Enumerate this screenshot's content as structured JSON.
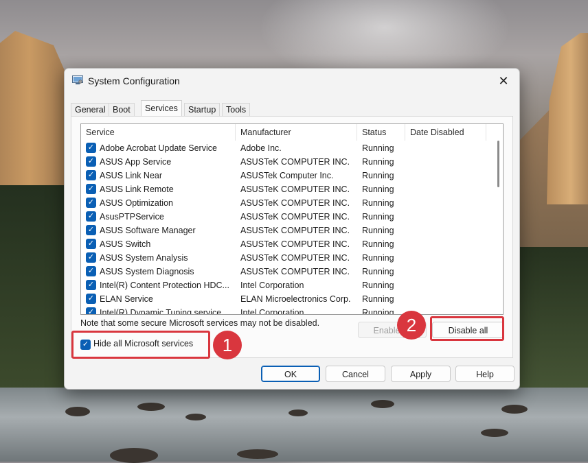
{
  "window": {
    "title": "System Configuration"
  },
  "tabs": [
    "General",
    "Boot",
    "Services",
    "Startup",
    "Tools"
  ],
  "active_tab": "Services",
  "columns": [
    "Service",
    "Manufacturer",
    "Status",
    "Date Disabled"
  ],
  "services": [
    {
      "name": "Adobe Acrobat Update Service",
      "manufacturer": "Adobe Inc.",
      "status": "Running",
      "date": "",
      "checked": true
    },
    {
      "name": "ASUS App Service",
      "manufacturer": "ASUSTeK COMPUTER INC.",
      "status": "Running",
      "date": "",
      "checked": true
    },
    {
      "name": "ASUS Link Near",
      "manufacturer": "ASUSTek Computer Inc.",
      "status": "Running",
      "date": "",
      "checked": true
    },
    {
      "name": "ASUS Link Remote",
      "manufacturer": "ASUSTeK COMPUTER INC.",
      "status": "Running",
      "date": "",
      "checked": true
    },
    {
      "name": "ASUS Optimization",
      "manufacturer": "ASUSTeK COMPUTER INC.",
      "status": "Running",
      "date": "",
      "checked": true
    },
    {
      "name": "AsusPTPService",
      "manufacturer": "ASUSTeK COMPUTER INC.",
      "status": "Running",
      "date": "",
      "checked": true
    },
    {
      "name": "ASUS Software Manager",
      "manufacturer": "ASUSTeK COMPUTER INC.",
      "status": "Running",
      "date": "",
      "checked": true
    },
    {
      "name": "ASUS Switch",
      "manufacturer": "ASUSTeK COMPUTER INC.",
      "status": "Running",
      "date": "",
      "checked": true
    },
    {
      "name": "ASUS System Analysis",
      "manufacturer": "ASUSTeK COMPUTER INC.",
      "status": "Running",
      "date": "",
      "checked": true
    },
    {
      "name": "ASUS System Diagnosis",
      "manufacturer": "ASUSTeK COMPUTER INC.",
      "status": "Running",
      "date": "",
      "checked": true
    },
    {
      "name": "Intel(R) Content Protection HDC...",
      "manufacturer": "Intel Corporation",
      "status": "Running",
      "date": "",
      "checked": true
    },
    {
      "name": "ELAN Service",
      "manufacturer": "ELAN Microelectronics Corp.",
      "status": "Running",
      "date": "",
      "checked": true
    },
    {
      "name": "Intel(R) Dynamic Tuning service",
      "manufacturer": "Intel Corporation",
      "status": "Running",
      "date": "",
      "checked": true
    }
  ],
  "note": "Note that some secure Microsoft services may not be disabled.",
  "buttons": {
    "enable_all": "Enable all",
    "disable_all": "Disable all",
    "ok": "OK",
    "cancel": "Cancel",
    "apply": "Apply",
    "help": "Help"
  },
  "hide_ms": {
    "label": "Hide all Microsoft services",
    "checked": true
  },
  "markers": [
    "1",
    "2"
  ],
  "colors": {
    "accent": "#0a5fb4",
    "highlight": "#d9363e"
  },
  "icons": {
    "app": "system-config-icon",
    "close": "close-icon",
    "check": "checkmark-icon"
  }
}
